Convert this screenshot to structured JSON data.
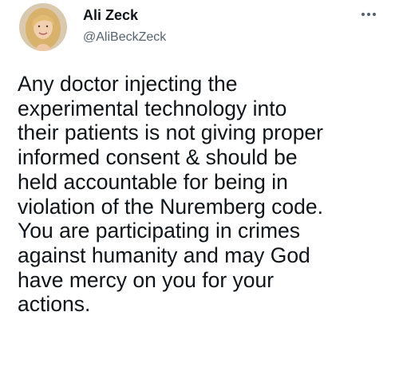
{
  "tweet": {
    "author": {
      "display_name": "Ali Zeck",
      "handle": "@AliBeckZeck",
      "avatar_icon": "profile-photo-avatar"
    },
    "more_icon": "more-dots-icon",
    "text_lines": [
      "Any doctor injecting the",
      "experimental technology into",
      "their patients is not giving proper",
      "informed consent & should be",
      "held accountable for being in",
      "violation of the Nuremberg code.",
      "You are participating in crimes",
      "against humanity and may God",
      "have mercy on you for your",
      "actions."
    ]
  },
  "colors": {
    "text": "#0f1419",
    "secondary_text": "#536471",
    "background": "#ffffff"
  }
}
